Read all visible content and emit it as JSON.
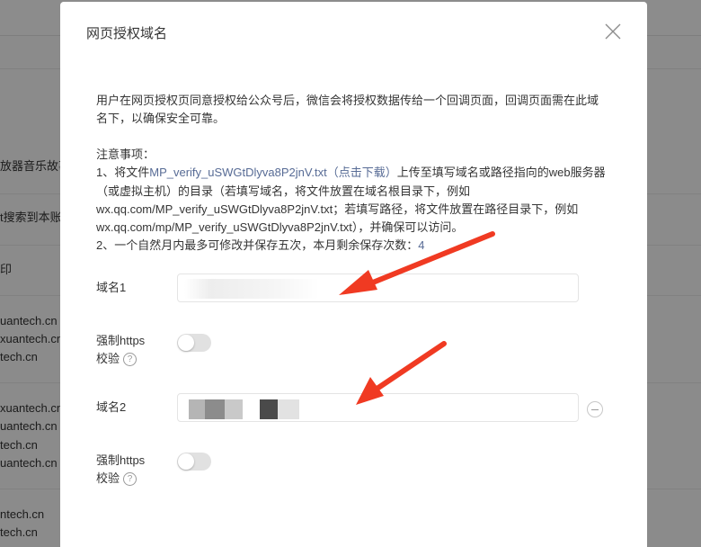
{
  "background": {
    "rows": [
      "放器音乐故事",
      "t搜索到本账",
      "印",
      "uantech.cn",
      "xuantech.cn",
      "tech.cn",
      "xuantech.cn",
      "uantech.cn",
      "tech.cn",
      "uantech.cn",
      "ntech.cn",
      "tech.cn"
    ]
  },
  "dialog": {
    "title": "网页授权域名",
    "description": "用户在网页授权页同意授权给公众号后，微信会将授权数据传给一个回调页面，回调页面需在此域名下，以确保安全可靠。",
    "notes": {
      "heading": "注意事项：",
      "item1_prefix": "1、将文件",
      "item1_link": "MP_verify_uSWGtDlyva8P2jnV.txt（点击下载）",
      "item1_rest": "上传至填写域名或路径指向的web服务器（或虚拟主机）的目录（若填写域名，将文件放置在域名根目录下，例如wx.qq.com/MP_verify_uSWGtDlyva8P2jnV.txt；若填写路径，将文件放置在路径目录下，例如wx.qq.com/mp/MP_verify_uSWGtDlyva8P2jnV.txt），并确保可以访问。",
      "item2_prefix": "2、一个自然月内最多可修改并保存五次，本月剩余保存次数：",
      "item2_count": "4"
    },
    "domain1": {
      "label": "域名1",
      "value": ""
    },
    "https1": {
      "label_line1": "强制https",
      "label_line2": "校验",
      "help": "?"
    },
    "domain2": {
      "label": "域名2",
      "value": ""
    },
    "https2": {
      "label_line1": "强制https",
      "label_line2": "校验",
      "help": "?"
    }
  },
  "colors": {
    "link": "#576b95",
    "arrow": "#f03a22",
    "toggle_off": "#e1e1e1"
  }
}
